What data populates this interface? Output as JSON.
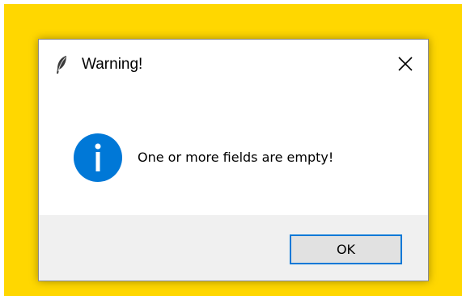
{
  "dialog": {
    "title": "Warning!",
    "app_icon": "feather-icon",
    "close_icon": "close-icon",
    "message_icon": "info-icon",
    "message": "One or more fields are empty!",
    "ok_label": "OK"
  },
  "colors": {
    "desktop_background": "#FFD700",
    "info_icon": "#0078d7",
    "button_focus_border": "#0078d7",
    "footer_background": "#f0f0f0"
  }
}
